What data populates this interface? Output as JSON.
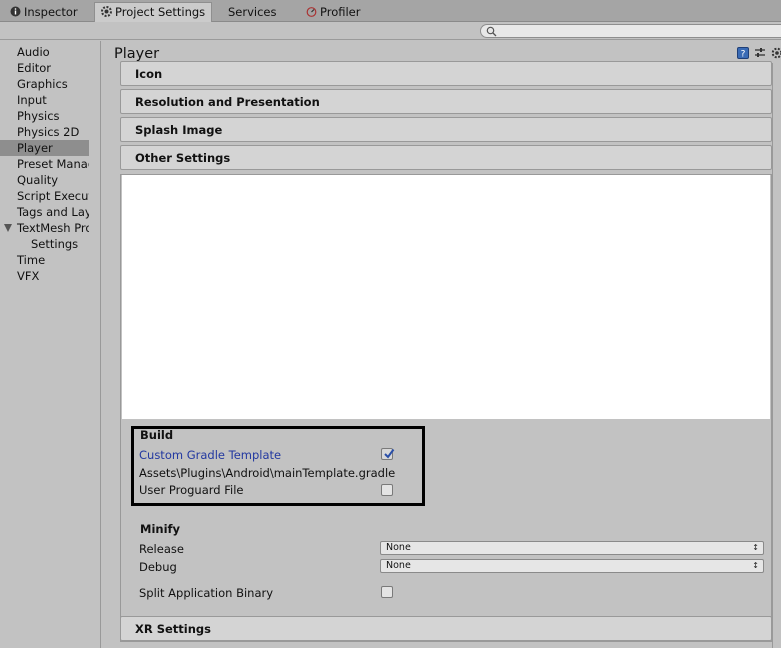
{
  "tabs": [
    {
      "label": "Inspector",
      "icon": "info-icon"
    },
    {
      "label": "Project Settings",
      "icon": "gear-icon",
      "active": true
    },
    {
      "label": "Services"
    },
    {
      "label": "Profiler",
      "icon": "profiler-icon"
    }
  ],
  "search": {
    "placeholder": ""
  },
  "nav": {
    "items": [
      "Audio",
      "Editor",
      "Graphics",
      "Input",
      "Physics",
      "Physics 2D",
      "Player",
      "Preset Manager",
      "Quality",
      "Script Execution Order",
      "Tags and Layers",
      "TextMesh Pro",
      "Settings",
      "Time",
      "VFX"
    ],
    "selected": "Player"
  },
  "main": {
    "title": "Player",
    "sections": {
      "icon": "Icon",
      "resolution": "Resolution and Presentation",
      "splash": "Splash Image",
      "other": "Other Settings",
      "xr": "XR Settings"
    },
    "build": {
      "label": "Build",
      "custom_gradle": "Custom Gradle Template",
      "custom_gradle_checked": true,
      "gradle_path": "Assets\\Plugins\\Android\\mainTemplate.gradle",
      "user_proguard": "User Proguard File",
      "user_proguard_checked": false
    },
    "minify": {
      "label": "Minify",
      "release_label": "Release",
      "release_value": "None",
      "debug_label": "Debug",
      "debug_value": "None"
    },
    "split_binary": {
      "label": "Split Application Binary",
      "checked": false
    }
  },
  "colors": {
    "accent_label": "#2238a0",
    "highlight_box": "#000000"
  }
}
